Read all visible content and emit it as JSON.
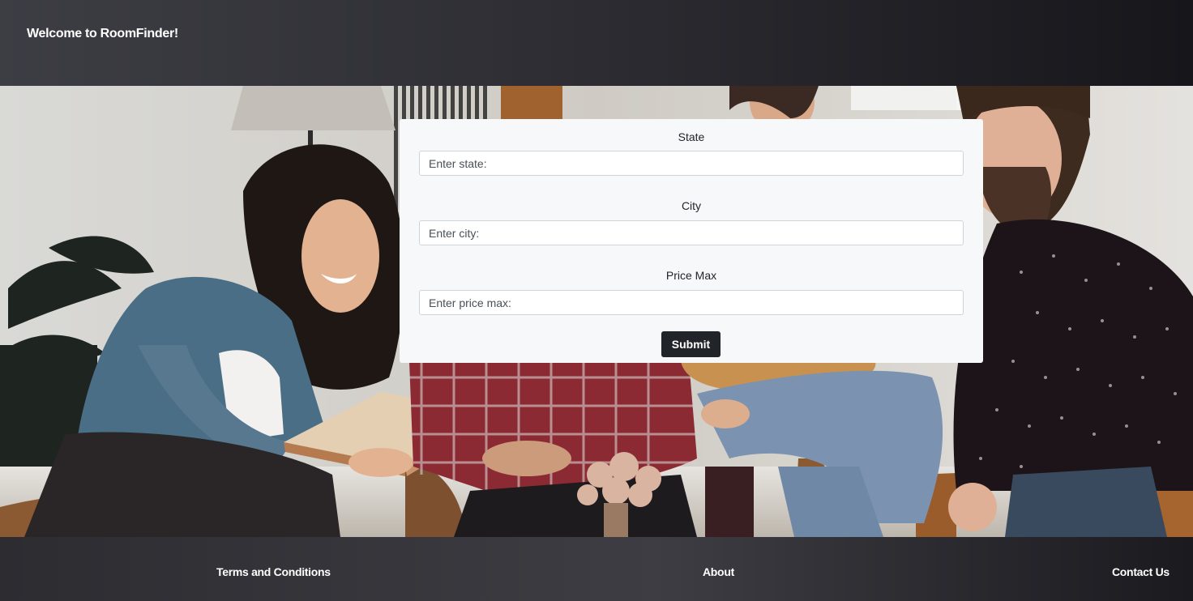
{
  "header": {
    "title": "Welcome to RoomFinder!"
  },
  "form": {
    "fields": [
      {
        "label": "State",
        "placeholder": "Enter state:",
        "value": ""
      },
      {
        "label": "City",
        "placeholder": "Enter city:",
        "value": ""
      },
      {
        "label": "Price Max",
        "placeholder": "Enter price max:",
        "value": ""
      }
    ],
    "submit_label": "Submit"
  },
  "footer": {
    "links": [
      "Terms and Conditions",
      "About",
      "Contact Us"
    ]
  },
  "colors": {
    "header_dark": "#2e2e34",
    "card_bg": "#f7f8fa",
    "button_bg": "#212529"
  },
  "hero": {
    "image": "photo-friends-reading-and-playing-guitar"
  }
}
